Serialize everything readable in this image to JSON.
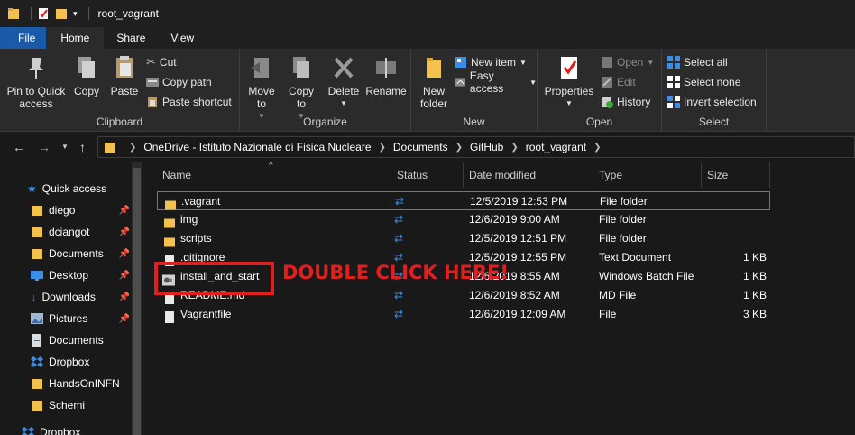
{
  "window": {
    "title": "root_vagrant"
  },
  "tabs": [
    {
      "label": "File"
    },
    {
      "label": "Home"
    },
    {
      "label": "Share"
    },
    {
      "label": "View"
    }
  ],
  "ribbon": {
    "clipboard": {
      "label": "Clipboard",
      "pin_label": "Pin to Quick access",
      "copy_label": "Copy",
      "paste_label": "Paste",
      "cut_label": "Cut",
      "copy_path_label": "Copy path",
      "paste_shortcut_label": "Paste shortcut"
    },
    "organize": {
      "label": "Organize",
      "move_to_label": "Move to",
      "copy_to_label": "Copy to",
      "delete_label": "Delete",
      "rename_label": "Rename"
    },
    "new": {
      "label": "New",
      "new_folder_label": "New folder",
      "new_item_label": "New item",
      "easy_access_label": "Easy access"
    },
    "open": {
      "label": "Open",
      "properties_label": "Properties",
      "open_label": "Open",
      "edit_label": "Edit",
      "history_label": "History"
    },
    "select": {
      "label": "Select",
      "select_all_label": "Select all",
      "select_none_label": "Select none",
      "invert_selection_label": "Invert selection"
    }
  },
  "breadcrumb": [
    "OneDrive - Istituto Nazionale di Fisica Nucleare",
    "Documents",
    "GitHub",
    "root_vagrant"
  ],
  "sidebar": {
    "items": [
      {
        "label": "Quick access",
        "icon": "star-icon"
      },
      {
        "label": "diego",
        "icon": "folder-icon",
        "pinned": true
      },
      {
        "label": "dciangot",
        "icon": "folder-icon",
        "pinned": true
      },
      {
        "label": "Documents",
        "icon": "folder-icon",
        "pinned": true
      },
      {
        "label": "Desktop",
        "icon": "desktop-icon",
        "pinned": true
      },
      {
        "label": "Downloads",
        "icon": "download-icon",
        "pinned": true
      },
      {
        "label": "Pictures",
        "icon": "pictures-icon",
        "pinned": true
      },
      {
        "label": "Documents",
        "icon": "documents-icon"
      },
      {
        "label": "Dropbox",
        "icon": "dropbox-icon"
      },
      {
        "label": "HandsOnINFN",
        "icon": "folder-icon"
      },
      {
        "label": "Schemi",
        "icon": "folder-icon"
      },
      {
        "label": "Dropbox",
        "icon": "dropbox-icon"
      }
    ]
  },
  "columns": {
    "name": "Name",
    "status": "Status",
    "date_modified": "Date modified",
    "type": "Type",
    "size": "Size"
  },
  "files": [
    {
      "name": ".vagrant",
      "date": "12/5/2019 12:53 PM",
      "type": "File folder",
      "size": "",
      "icon": "folder-icon"
    },
    {
      "name": "img",
      "date": "12/6/2019 9:00 AM",
      "type": "File folder",
      "size": "",
      "icon": "folder-icon"
    },
    {
      "name": "scripts",
      "date": "12/5/2019 12:51 PM",
      "type": "File folder",
      "size": "",
      "icon": "folder-icon"
    },
    {
      "name": ".gitignore",
      "date": "12/5/2019 12:55 PM",
      "type": "Text Document",
      "size": "1 KB",
      "icon": "file-icon"
    },
    {
      "name": "install_and_start",
      "date": "12/6/2019 8:55 AM",
      "type": "Windows Batch File",
      "size": "1 KB",
      "icon": "batch-file-icon"
    },
    {
      "name": "README.md",
      "date": "12/6/2019 8:52 AM",
      "type": "MD File",
      "size": "1 KB",
      "icon": "file-icon"
    },
    {
      "name": "Vagrantfile",
      "date": "12/6/2019 12:09 AM",
      "type": "File",
      "size": "3 KB",
      "icon": "file-icon"
    }
  ],
  "annotation": {
    "text": "DOUBLE CLICK HERE!",
    "color": "#e02020"
  },
  "colors": {
    "accent": "#1b5aa8",
    "sync": "#3b8ee8",
    "folder": "#f2c14e"
  }
}
